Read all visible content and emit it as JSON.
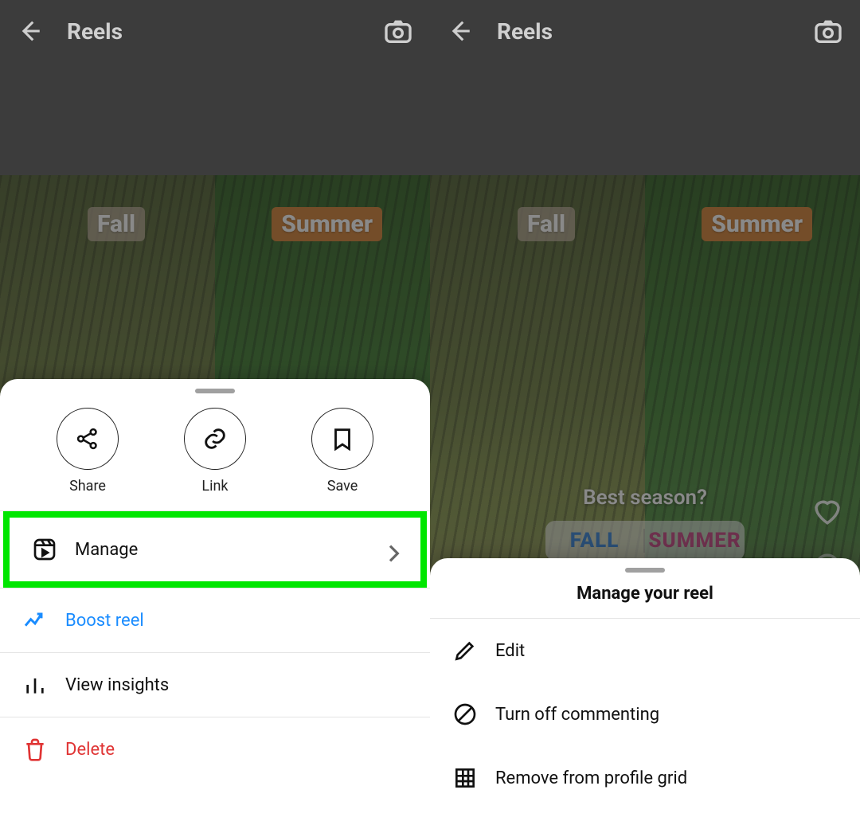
{
  "phone1": {
    "header": {
      "title": "Reels"
    },
    "reel": {
      "tag_left": "Fall",
      "tag_right": "Summer"
    },
    "sheet": {
      "circles": {
        "share": "Share",
        "link": "Link",
        "save": "Save"
      },
      "rows": {
        "manage": "Manage",
        "boost": "Boost reel",
        "insights": "View insights",
        "delete": "Delete"
      }
    }
  },
  "phone2": {
    "header": {
      "title": "Reels"
    },
    "reel": {
      "tag_left": "Fall",
      "tag_right": "Summer",
      "poll_question": "Best season?",
      "poll_opt_left": "FALL",
      "poll_opt_right": "SUMMER"
    },
    "sheet": {
      "title": "Manage your reel",
      "rows": {
        "edit": "Edit",
        "turnoff": "Turn off commenting",
        "removegrid": "Remove from profile grid"
      }
    }
  }
}
